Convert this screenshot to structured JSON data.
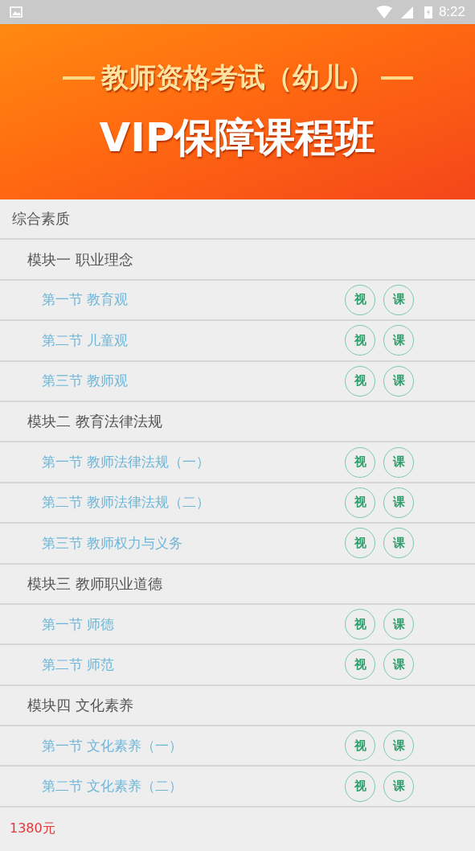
{
  "status_bar": {
    "time": "8:22"
  },
  "banner": {
    "subtitle": "教师资格考试（幼儿）",
    "title": "VIP保障课程班"
  },
  "category": {
    "title": "综合素质",
    "modules": [
      {
        "title": "模块一 职业理念",
        "lessons": [
          {
            "title": "第一节 教育观",
            "buttons": [
              "视",
              "课"
            ]
          },
          {
            "title": "第二节 儿童观",
            "buttons": [
              "视",
              "课"
            ]
          },
          {
            "title": "第三节 教师观",
            "buttons": [
              "视",
              "课"
            ]
          }
        ]
      },
      {
        "title": "模块二 教育法律法规",
        "lessons": [
          {
            "title": "第一节 教师法律法规（一）",
            "buttons": [
              "视",
              "课"
            ]
          },
          {
            "title": "第二节 教师法律法规（二）",
            "buttons": [
              "视",
              "课"
            ]
          },
          {
            "title": "第三节 教师权力与义务",
            "buttons": [
              "视",
              "课"
            ]
          }
        ]
      },
      {
        "title": "模块三 教师职业道德",
        "lessons": [
          {
            "title": "第一节 师德",
            "buttons": [
              "视",
              "课"
            ]
          },
          {
            "title": "第二节 师范",
            "buttons": [
              "视",
              "课"
            ]
          }
        ]
      },
      {
        "title": "模块四 文化素养",
        "lessons": [
          {
            "title": "第一节 文化素养（一）",
            "buttons": [
              "视",
              "课"
            ]
          },
          {
            "title": "第二节 文化素养（二）",
            "buttons": [
              "视",
              "课"
            ]
          }
        ]
      }
    ]
  },
  "footer": {
    "price": "1380元"
  }
}
